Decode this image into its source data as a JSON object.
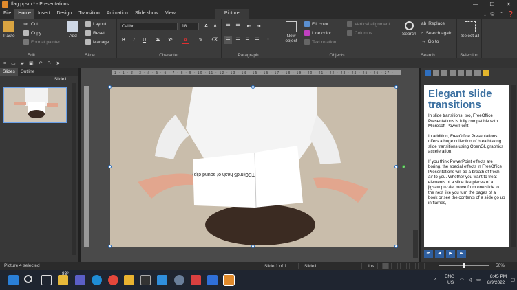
{
  "window": {
    "title": "flag.ppsm * - Presentations",
    "controls": [
      "—",
      "☐",
      "✕"
    ]
  },
  "menu": {
    "items": [
      "File",
      "Home",
      "Insert",
      "Design",
      "Transition",
      "Animation",
      "Slide show",
      "View"
    ],
    "active": "Home",
    "context_tab": "Picture",
    "icons": [
      "↓",
      "©",
      "⌃",
      "❓"
    ]
  },
  "ribbon": {
    "edit": {
      "label": "Edit",
      "paste": "Paste",
      "cut": "Cut",
      "copy": "Copy",
      "format_painter": "Format painter"
    },
    "slide": {
      "label": "Slide",
      "add": "Add",
      "layout": "Layout",
      "reset": "Reset",
      "manage": "Manage"
    },
    "character": {
      "label": "Character",
      "font": "Calibri",
      "size": "18",
      "bold": "B",
      "italic": "I",
      "underline": "U",
      "strike": "S",
      "color": "A"
    },
    "paragraph": {
      "label": "Paragraph"
    },
    "objects": {
      "label": "Objects",
      "new_object": "New object",
      "fill_color": "Fill color",
      "line_color": "Line color",
      "text_rotation": "Text rotation",
      "vertical_alignment": "Vertical alignment",
      "columns": "Columns"
    },
    "search": {
      "label": "Search",
      "search": "Search",
      "replace": "Replace",
      "search_again": "Search again",
      "go_to": "Go to"
    },
    "selection": {
      "label": "Selection",
      "select_all": "Select all"
    }
  },
  "left_panel": {
    "tabs": [
      "Slides",
      "Outline"
    ],
    "active_tab": "Slides",
    "slide_name": "Slide1"
  },
  "slide": {
    "book_text": "TSC(md5 hash of sound clip)"
  },
  "ruler": {
    "marks": "1 · 1 · 2 · 3 · 4 · 5 · 6 · 7 · 8 · 9 · 10 · 11 · 12 · 13 · 14 · 15 · 16 · 17 · 18 · 19 · 20 · 21 · 22 · 23 · 24 · 25 · 26 · 27 · 28 ·"
  },
  "right_panel": {
    "heading": "Elegant slide transitions",
    "p1": "In slide transitions, too, FreeOffice Presentations is fully compatible with Microsoft PowerPoint.",
    "p2": "In addition, FreeOffice Presentations offers a huge collection of breathtaking slide transitions using OpenGL graphics acceleration.",
    "p3": "If you think PowerPoint effects are boring, the special effects in FreeOffice Presentations will be a breath of fresh air to you. Whether you want to treat elements of a slide like pieces of a jigsaw puzzle, move from one slide to the next like you turn the pages of a book or see the contents of a slide go up in flames,"
  },
  "status": {
    "selection": "Picture 4 selected",
    "slide_of": "Slide 1 of 1",
    "slide_name": "Slide1",
    "mode": "Ins",
    "zoom": "50%",
    "zoom_fraction": 0.5
  },
  "taskbar": {
    "weather": "83°",
    "lang1": "ENG",
    "lang2": "US",
    "time": "8:45 PM",
    "date": "8/9/2022"
  },
  "colors": {
    "accent": "#2f6fbf",
    "heading": "#3a6fa0",
    "titlebar": "#2b2b2b",
    "ribbon": "#3b3b3b"
  }
}
